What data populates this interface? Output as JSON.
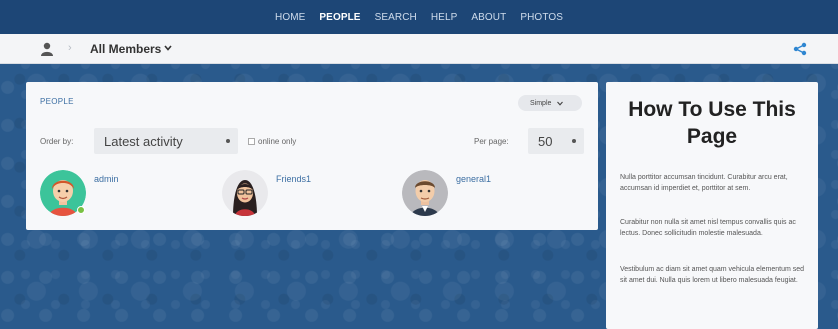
{
  "topnav": {
    "items": [
      "HOME",
      "PEOPLE",
      "SEARCH",
      "HELP",
      "ABOUT",
      "PHOTOS"
    ],
    "active": "PEOPLE"
  },
  "breadcrumb": {
    "label": "All Members"
  },
  "members_panel": {
    "title": "PEOPLE",
    "view_mode": "Simple",
    "order_label": "Order by:",
    "order_value": "Latest activity",
    "online_only_label": "online only",
    "perpage_label": "Per page:",
    "perpage_value": "50",
    "members": [
      {
        "name": "admin",
        "online": true,
        "avatar": "boy-avatar-icon"
      },
      {
        "name": "Friends1",
        "online": false,
        "avatar": "girl-avatar-icon"
      },
      {
        "name": "general1",
        "online": false,
        "avatar": "man-avatar-icon"
      }
    ]
  },
  "help": {
    "title": "How To Use This Page",
    "paragraphs": [
      "Nulla porttitor accumsan tincidunt. Curabitur arcu erat, accumsan id imperdiet et, porttitor at sem.",
      "Curabitur non nulla sit amet nisl tempus convallis quis ac lectus. Donec sollicitudin molestie malesuada.",
      "Vestibulum ac diam sit amet quam vehicula elementum sed sit amet dui. Nulla quis lorem ut libero malesuada feugiat."
    ]
  },
  "colors": {
    "nav_bg": "#1d4676",
    "link": "#3d6fa3",
    "online": "#79c143",
    "share": "#2f86d1"
  }
}
